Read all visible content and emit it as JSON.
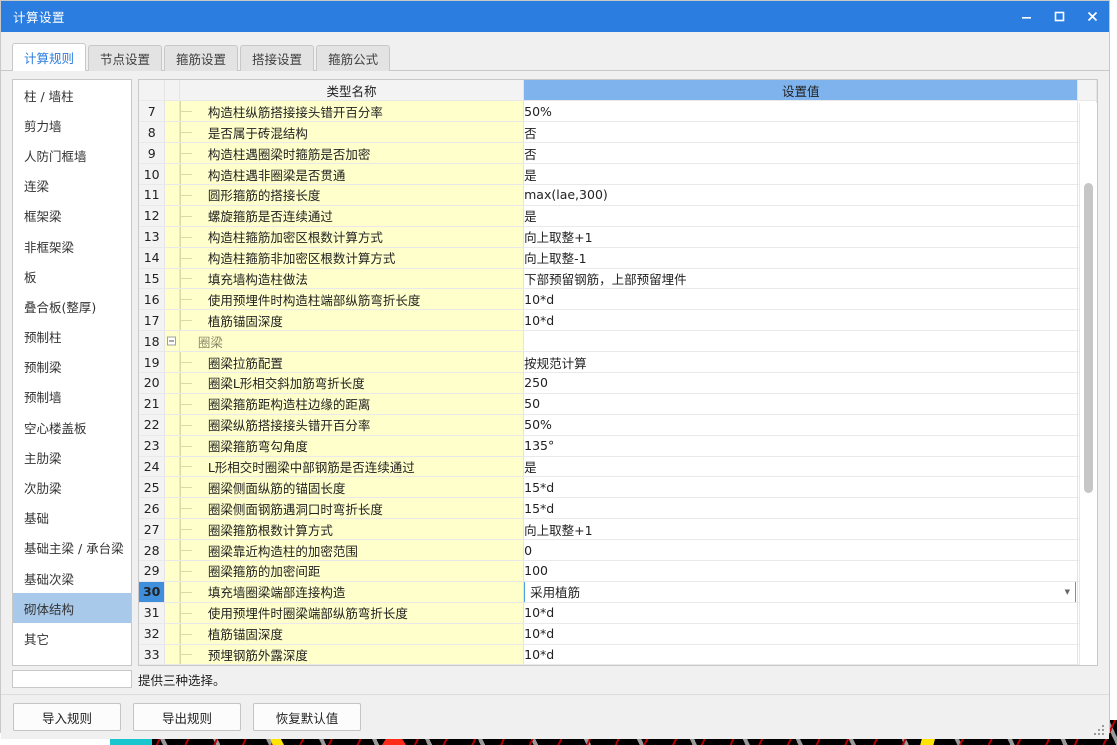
{
  "window": {
    "title": "计算设置",
    "buttons": {
      "minimize": "minimize-icon",
      "maximize": "maximize-icon",
      "close": "close-icon"
    }
  },
  "tabs": [
    {
      "label": "计算规则",
      "active": true
    },
    {
      "label": "节点设置",
      "active": false
    },
    {
      "label": "箍筋设置",
      "active": false
    },
    {
      "label": "搭接设置",
      "active": false
    },
    {
      "label": "箍筋公式",
      "active": false
    }
  ],
  "sidebar": {
    "items": [
      {
        "label": "柱 / 墙柱",
        "active": false
      },
      {
        "label": "剪力墙",
        "active": false
      },
      {
        "label": "人防门框墙",
        "active": false
      },
      {
        "label": "连梁",
        "active": false
      },
      {
        "label": "框架梁",
        "active": false
      },
      {
        "label": "非框架梁",
        "active": false
      },
      {
        "label": "板",
        "active": false
      },
      {
        "label": "叠合板(整厚)",
        "active": false
      },
      {
        "label": "预制柱",
        "active": false
      },
      {
        "label": "预制梁",
        "active": false
      },
      {
        "label": "预制墙",
        "active": false
      },
      {
        "label": "空心楼盖板",
        "active": false
      },
      {
        "label": "主肋梁",
        "active": false
      },
      {
        "label": "次肋梁",
        "active": false
      },
      {
        "label": "基础",
        "active": false
      },
      {
        "label": "基础主梁 / 承台梁",
        "active": false
      },
      {
        "label": "基础次梁",
        "active": false
      },
      {
        "label": "砌体结构",
        "active": true
      },
      {
        "label": "其它",
        "active": false
      }
    ]
  },
  "grid": {
    "headers": {
      "name": "类型名称",
      "value": "设置值"
    },
    "rows": [
      {
        "num": "7",
        "type": "leaf",
        "name": "构造柱纵筋搭接接头错开百分率",
        "value": "50%"
      },
      {
        "num": "8",
        "type": "leaf",
        "name": "是否属于砖混结构",
        "value": "否"
      },
      {
        "num": "9",
        "type": "leaf",
        "name": "构造柱遇圈梁时箍筋是否加密",
        "value": "否"
      },
      {
        "num": "10",
        "type": "leaf",
        "name": "构造柱遇非圈梁是否贯通",
        "value": "是"
      },
      {
        "num": "11",
        "type": "leaf",
        "name": "圆形箍筋的搭接长度",
        "value": "max(lae,300)"
      },
      {
        "num": "12",
        "type": "leaf",
        "name": "螺旋箍筋是否连续通过",
        "value": "是"
      },
      {
        "num": "13",
        "type": "leaf",
        "name": "构造柱箍筋加密区根数计算方式",
        "value": "向上取整+1"
      },
      {
        "num": "14",
        "type": "leaf",
        "name": "构造柱箍筋非加密区根数计算方式",
        "value": "向上取整-1"
      },
      {
        "num": "15",
        "type": "leaf",
        "name": "填充墙构造柱做法",
        "value": "下部预留钢筋，上部预留埋件"
      },
      {
        "num": "16",
        "type": "leaf",
        "name": "使用预埋件时构造柱端部纵筋弯折长度",
        "value": "10*d"
      },
      {
        "num": "17",
        "type": "leaf",
        "name": "植筋锚固深度",
        "value": "10*d"
      },
      {
        "num": "18",
        "type": "group",
        "name": "圈梁",
        "value": ""
      },
      {
        "num": "19",
        "type": "leaf",
        "name": "圈梁拉筋配置",
        "value": "按规范计算"
      },
      {
        "num": "20",
        "type": "leaf",
        "name": "圈梁L形相交斜加筋弯折长度",
        "value": "250"
      },
      {
        "num": "21",
        "type": "leaf",
        "name": "圈梁箍筋距构造柱边缘的距离",
        "value": "50"
      },
      {
        "num": "22",
        "type": "leaf",
        "name": "圈梁纵筋搭接接头错开百分率",
        "value": "50%"
      },
      {
        "num": "23",
        "type": "leaf",
        "name": "圈梁箍筋弯勾角度",
        "value": "135°"
      },
      {
        "num": "24",
        "type": "leaf",
        "name": "L形相交时圈梁中部钢筋是否连续通过",
        "value": "是"
      },
      {
        "num": "25",
        "type": "leaf",
        "name": "圈梁侧面纵筋的锚固长度",
        "value": "15*d"
      },
      {
        "num": "26",
        "type": "leaf",
        "name": "圈梁侧面钢筋遇洞口时弯折长度",
        "value": "15*d"
      },
      {
        "num": "27",
        "type": "leaf",
        "name": "圈梁箍筋根数计算方式",
        "value": "向上取整+1"
      },
      {
        "num": "28",
        "type": "leaf",
        "name": "圈梁靠近构造柱的加密范围",
        "value": "0"
      },
      {
        "num": "29",
        "type": "leaf",
        "name": "圈梁箍筋的加密间距",
        "value": "100"
      },
      {
        "num": "30",
        "type": "leaf",
        "name": "填充墙圈梁端部连接构造",
        "value": "采用植筋",
        "selected": true,
        "editing": true
      },
      {
        "num": "31",
        "type": "leaf",
        "name": "使用预埋件时圈梁端部纵筋弯折长度",
        "value": "10*d"
      },
      {
        "num": "32",
        "type": "leaf",
        "name": "植筋锚固深度",
        "value": "10*d"
      },
      {
        "num": "33",
        "type": "leaf",
        "name": "预埋钢筋外露深度",
        "value": "10*d"
      }
    ]
  },
  "description": "提供三种选择。",
  "footer": {
    "buttons": [
      {
        "label": "导入规则"
      },
      {
        "label": "导出规则"
      },
      {
        "label": "恢复默认值"
      }
    ]
  },
  "colors": {
    "titlebar": "#2b7de0",
    "value_header": "#7fb3ed",
    "row_yellow": "#ffffcc",
    "selection": "#3f8fdc",
    "sidebar_active": "#a8c9ea"
  }
}
